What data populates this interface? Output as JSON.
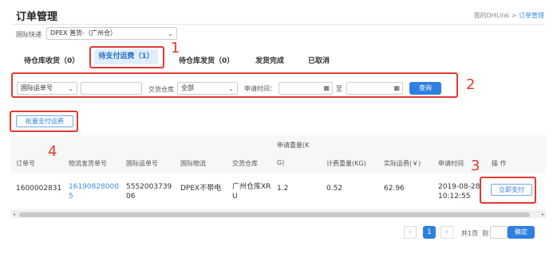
{
  "header": {
    "title": "订单管理",
    "breadcrumb_parent": "我的DHLink",
    "breadcrumb_sep": ">",
    "breadcrumb_current": "订单管理"
  },
  "filter_top": {
    "label": "国际快递",
    "value": "DPEX 普货-（广州仓）"
  },
  "tabs": [
    {
      "label": "待仓库收货（0）"
    },
    {
      "label": "待支付运费（1）"
    },
    {
      "label": "待仓库发货（0）"
    },
    {
      "label": "发货完成"
    },
    {
      "label": "已取消"
    }
  ],
  "search": {
    "type_select": "国际运单号",
    "type_input": "",
    "warehouse_label": "交货仓库",
    "warehouse_value": "全部",
    "time_label": "申请时间：",
    "to_label": "至",
    "query_button": "查询"
  },
  "batch_pay_button": "批量支付运费",
  "annotations": {
    "n1": "1",
    "n2": "2",
    "n3": "3",
    "n4": "4"
  },
  "table": {
    "headers": {
      "order_no": "订单号",
      "logistics_no": "物流发货单号",
      "intl_no": "国际运单号",
      "intl_logistics": "国际物流",
      "warehouse": "交货仓库",
      "apply_weight_1": "申请重量(K",
      "apply_weight_2": "G)",
      "charge_weight": "计费重量(KG)",
      "actual_freight": "实际运费(￥)",
      "apply_time": "申请时间",
      "action": "操 作"
    },
    "row": {
      "order_no": "1600002831",
      "logistics_no_1": "16190828000",
      "logistics_no_2": "5",
      "intl_no_1": "5552003739",
      "intl_no_2": "06",
      "intl_logistics": "DPEX不带电",
      "warehouse_1": "广州仓库XR",
      "warehouse_2": "U",
      "apply_weight": "1.2",
      "charge_weight": "0.52",
      "actual_freight": "62.96",
      "apply_time_1": "2019-08-28",
      "apply_time_2": "10:12:55",
      "pay_button": "立即支付"
    }
  },
  "pagination": {
    "prev": "‹",
    "current": "1",
    "next": "›",
    "total": "共1页",
    "goto": "到",
    "confirm": "确定"
  },
  "colors": {
    "accent": "#2f7fe0",
    "annotation": "#e23a2f"
  }
}
